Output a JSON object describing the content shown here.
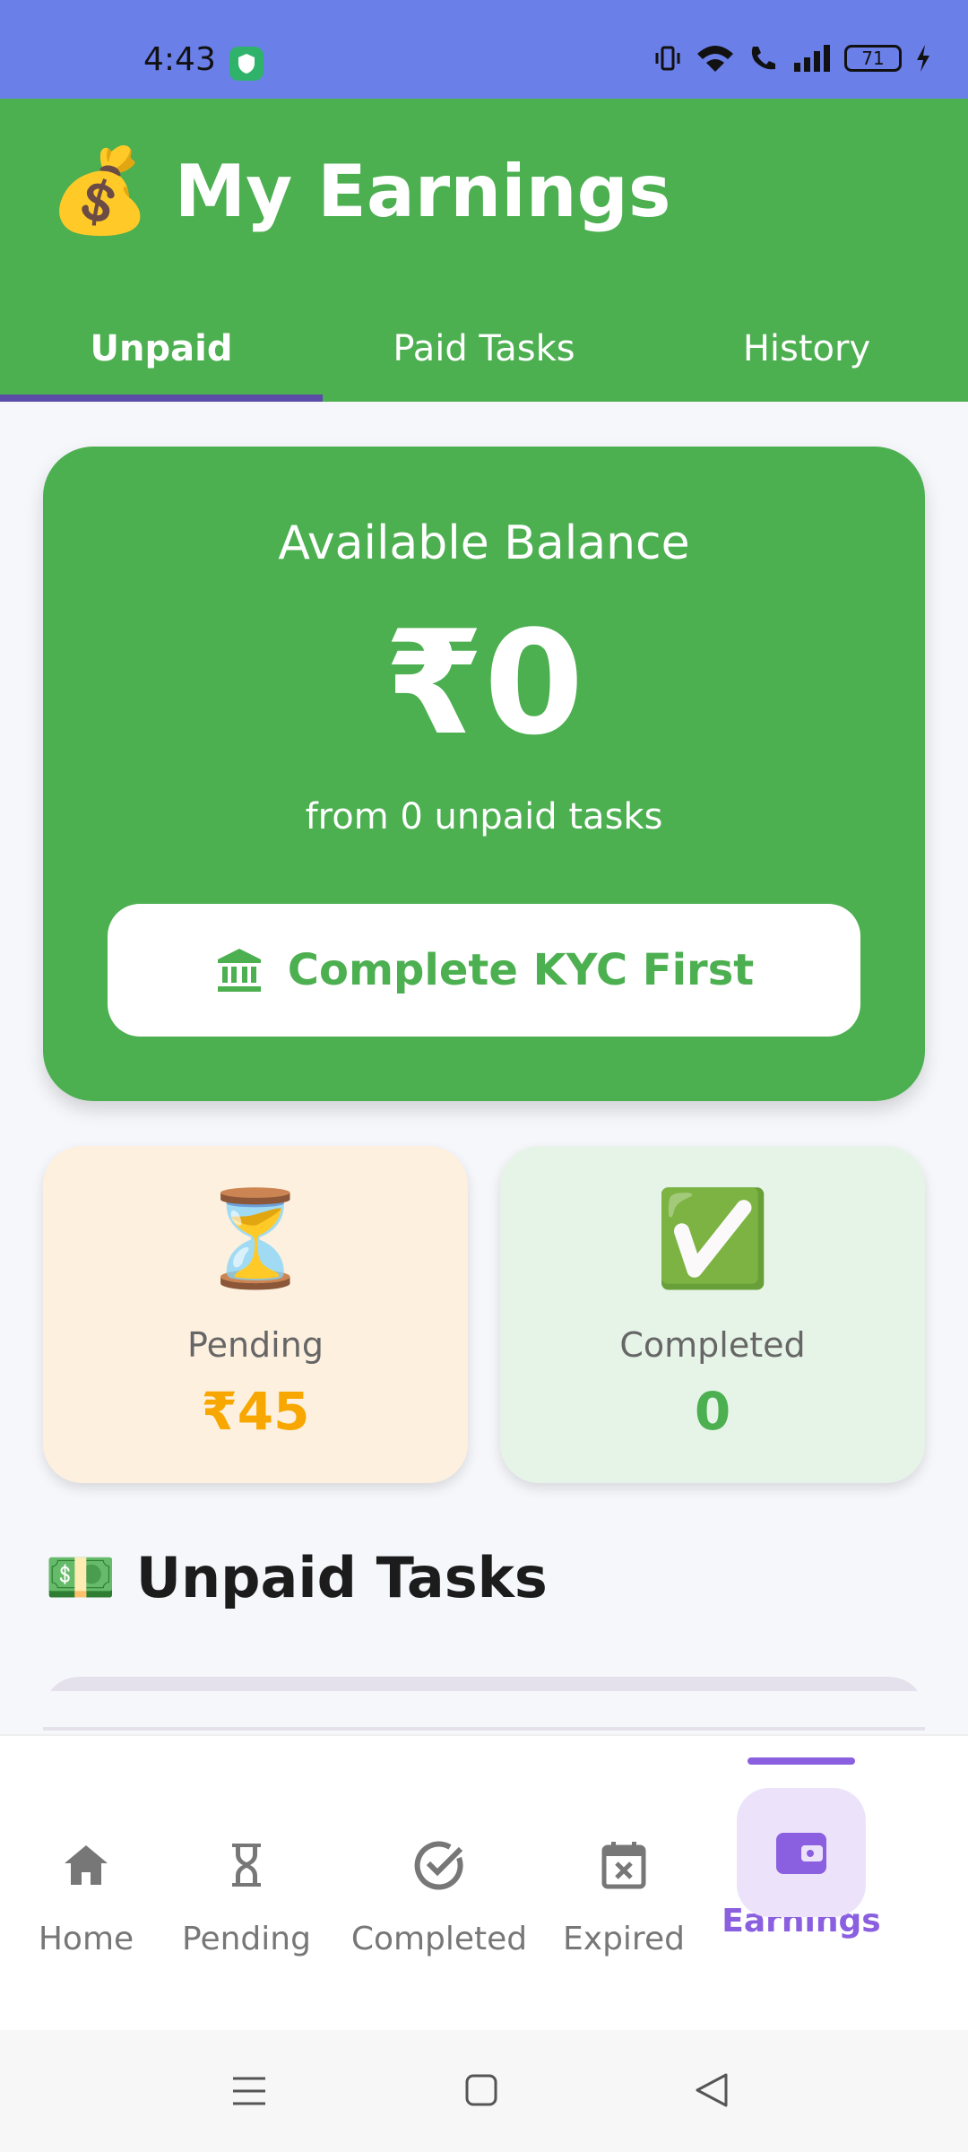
{
  "status_bar": {
    "time": "4:43",
    "battery": "71"
  },
  "header": {
    "emoji": "💰",
    "title": "My Earnings"
  },
  "tabs": [
    {
      "label": "Unpaid",
      "active": true
    },
    {
      "label": "Paid Tasks",
      "active": false
    },
    {
      "label": "History",
      "active": false
    }
  ],
  "balance": {
    "label": "Available Balance",
    "amount": "₹0",
    "subtitle": "from 0 unpaid tasks",
    "kyc_button": "Complete KYC First"
  },
  "stats": {
    "pending": {
      "icon": "⏳",
      "label": "Pending",
      "value": "₹45"
    },
    "completed": {
      "icon": "✅",
      "label": "Completed",
      "value": "0"
    }
  },
  "section": {
    "emoji": "💵",
    "title": "Unpaid Tasks"
  },
  "bottom_nav": [
    {
      "label": "Home",
      "icon": "home-icon"
    },
    {
      "label": "Pending",
      "icon": "hourglass-icon"
    },
    {
      "label": "Completed",
      "icon": "check-circle-icon"
    },
    {
      "label": "Expired",
      "icon": "calendar-x-icon"
    },
    {
      "label": "Earnings",
      "icon": "wallet-icon",
      "active": true
    }
  ],
  "colors": {
    "primary": "#4caf50",
    "accent": "#8a5fe0",
    "status_bar": "#6a7fe8",
    "pending": "#f7a700"
  }
}
